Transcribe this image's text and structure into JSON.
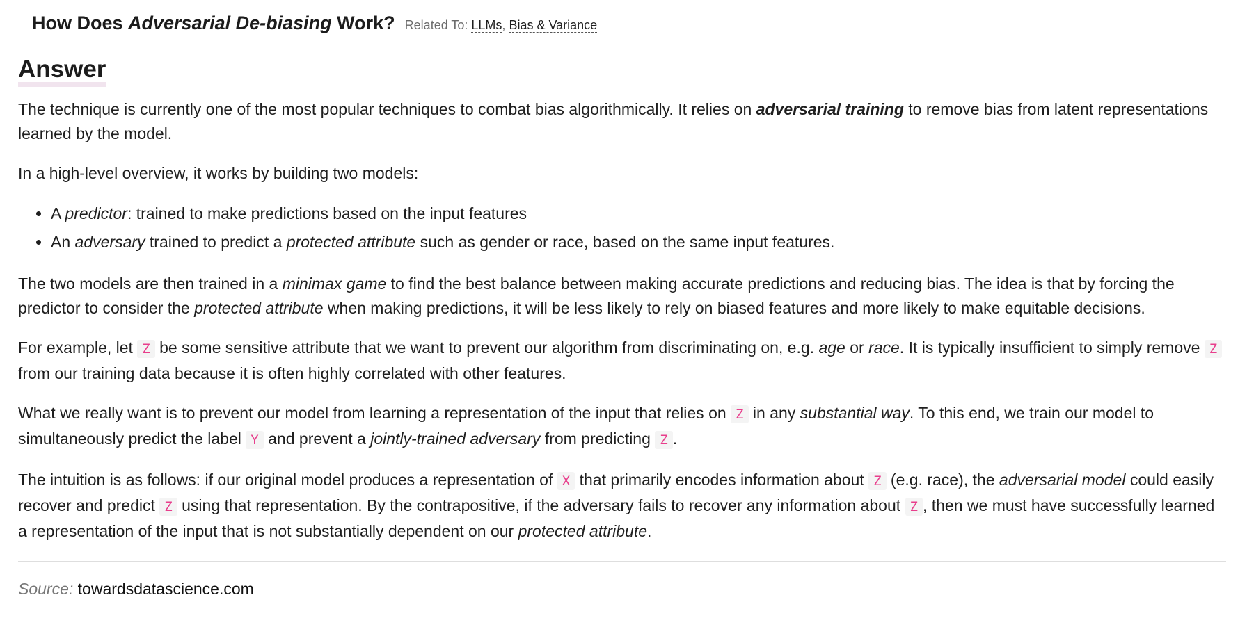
{
  "header": {
    "title_prefix": "How Does ",
    "title_em": "Adversarial De-biasing",
    "title_suffix": " Work?",
    "related_label": "Related To: ",
    "related_links": [
      "LLMs",
      "Bias & Variance"
    ],
    "related_sep": ", "
  },
  "answer": {
    "heading": "Answer",
    "p1": {
      "a": "The technique is currently one of the most popular techniques to combat bias algorithmically. It relies on ",
      "strong": "adversarial training",
      "b": " to remove bias from latent representations learned by the model."
    },
    "p2": "In a high-level overview, it works by building two models:",
    "list": [
      {
        "a": "A ",
        "em": "predictor",
        "b": ": trained to make predictions based on the input features"
      },
      {
        "a": "An ",
        "em": "adversary",
        "b": " trained to predict a ",
        "em2": "protected attribute",
        "c": " such as gender or race, based on the same input features."
      }
    ],
    "p3": {
      "a": "The two models are then trained in a ",
      "em1": "minimax game",
      "b": " to find the best balance between making accurate predictions and reducing bias. The idea is that by forcing the predictor to consider the ",
      "em2": "protected attribute",
      "c": " when making predictions, it will be less likely to rely on biased features and more likely to make equitable decisions."
    },
    "p4": {
      "a": "For example, let ",
      "code1": "Z",
      "b": " be some sensitive attribute that we want to prevent our algorithm from discriminating on, e.g. ",
      "em1": "age",
      "c": " or ",
      "em2": "race",
      "d": ". It is typically insufficient to simply remove ",
      "code2": "Z",
      "e": " from our training data because it is often highly correlated with other features."
    },
    "p5": {
      "a": "What we really want is to prevent our model from learning a representation of the input that relies on ",
      "code1": "Z",
      "b": " in any ",
      "em1": "substantial way",
      "c": ". To this end, we train our model to simultaneously predict the label ",
      "code2": "Y",
      "d": " and prevent a ",
      "em2": "jointly-trained adversary",
      "e": " from predicting ",
      "code3": "Z",
      "f": "."
    },
    "p6": {
      "a": "The intuition is as follows: if our original model produces a representation of ",
      "code1": "X",
      "b": " that primarily encodes information about ",
      "code2": "Z",
      "c": " (e.g. race), the ",
      "em1": "adversarial model",
      "d": " could easily recover and predict ",
      "code3": "Z",
      "e": " using that representation. By the contrapositive, if the adversary fails to recover any information about ",
      "code4": "Z",
      "f": ", then we must have successfully learned a representation of the input that is not substantially dependent on our ",
      "em2": "protected attribute",
      "g": "."
    }
  },
  "source": {
    "label": "Source:",
    "value": "towardsdatascience.com"
  }
}
